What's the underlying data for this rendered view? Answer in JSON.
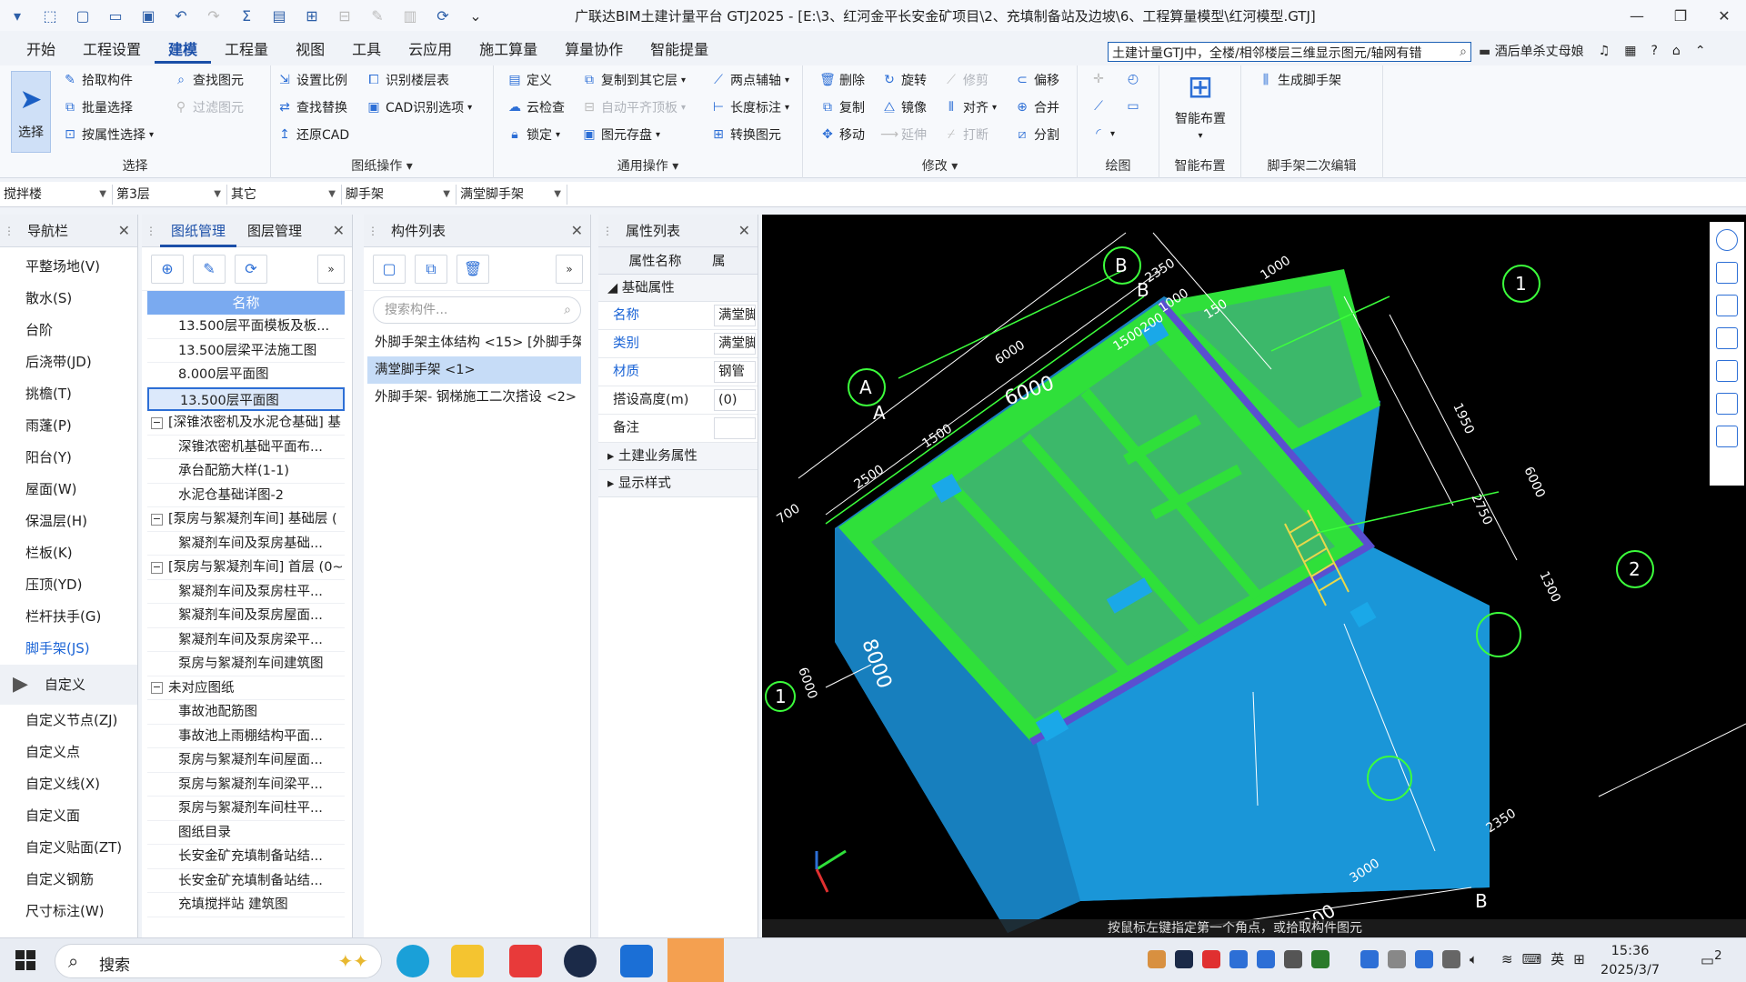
{
  "titlebar": {
    "title": "广联达BIM土建计量平台 GTJ2025 - [E:\\3、红河金平长安金矿项目\\2、充填制备站及边坡\\6、工程算量模型\\红河模型.GTJ]"
  },
  "menu": {
    "tabs": [
      "开始",
      "工程设置",
      "建模",
      "工程量",
      "视图",
      "工具",
      "云应用",
      "施工算量",
      "算量协作",
      "智能提量"
    ],
    "active": "建模",
    "search_value": "土建计量GTJ中，全楼/相邻楼层三维显示图元/轴网有错",
    "news": "酒后单杀丈母娘",
    "help": "?"
  },
  "ribbon": {
    "select_group": {
      "title": "选择",
      "select_btn": "选择",
      "pick": "拾取构件",
      "batch": "批量选择",
      "by_prop": "按属性选择",
      "find": "查找图元",
      "filter": "过滤图元"
    },
    "drawing_group": {
      "title": "图纸操作",
      "set_scale": "设置比例",
      "recog_floor": "识别楼层表",
      "find_replace": "查找替换",
      "cad_options": "CAD识别选项",
      "restore_cad": "还原CAD"
    },
    "general_group": {
      "title": "通用操作",
      "define": "定义",
      "copy_floor": "复制到其它层",
      "two_point": "两点辅轴",
      "cloud_check": "云检查",
      "auto_flat": "自动平齐顶板",
      "length_mark": "长度标注",
      "lock": "锁定",
      "save_elem": "图元存盘",
      "convert": "转换图元"
    },
    "modify_group": {
      "title": "修改",
      "delete": "删除",
      "rotate": "旋转",
      "trim": "修剪",
      "offset": "偏移",
      "copy": "复制",
      "mirror": "镜像",
      "align": "对齐",
      "merge": "合并",
      "move": "移动",
      "extend": "延伸",
      "break": "打断",
      "split": "分割"
    },
    "draw_group": {
      "title": "绘图"
    },
    "smart_group": {
      "title": "智能布置",
      "btn": "智能布置"
    },
    "scaffold_group": {
      "title": "脚手架二次编辑",
      "btn": "生成脚手架"
    }
  },
  "dropbar": {
    "d1": "搅拌楼",
    "d2": "第3层",
    "d3": "其它",
    "d4": "脚手架",
    "d5": "满堂脚手架"
  },
  "nav": {
    "title": "导航栏",
    "items_top": [
      "平整场地(V)",
      "散水(S)",
      "台阶",
      "后浇带(JD)",
      "挑檐(T)",
      "雨蓬(P)",
      "阳台(Y)",
      "屋面(W)",
      "保温层(H)",
      "栏板(K)",
      "压顶(YD)",
      "栏杆扶手(G)",
      "脚手架(JS)"
    ],
    "group": "自定义",
    "items_bottom": [
      "自定义节点(ZJ)",
      "自定义点",
      "自定义线(X)",
      "自定义面",
      "自定义贴面(ZT)",
      "自定义钢筋",
      "尺寸标注(W)"
    ]
  },
  "drawings": {
    "tab1": "图纸管理",
    "tab2": "图层管理",
    "col_name": "名称",
    "rows": [
      {
        "t": "leaf",
        "text": "13.500层平面模板及板..."
      },
      {
        "t": "leaf",
        "text": "13.500层梁平法施工图"
      },
      {
        "t": "leaf",
        "text": "8.000层平面图"
      },
      {
        "t": "sel",
        "text": "13.500层平面图"
      },
      {
        "t": "group",
        "text": "[深锥浓密机及水泥仓基础] 基"
      },
      {
        "t": "leaf",
        "text": "深锥浓密机基础平面布..."
      },
      {
        "t": "leaf",
        "text": "承台配筋大样(1-1)"
      },
      {
        "t": "leaf",
        "text": "水泥仓基础详图-2"
      },
      {
        "t": "group",
        "text": "[泵房与絮凝剂车间] 基础层 ("
      },
      {
        "t": "leaf",
        "text": "絮凝剂车间及泵房基础..."
      },
      {
        "t": "group",
        "text": "[泵房与絮凝剂车间] 首层 (0~"
      },
      {
        "t": "leaf",
        "text": "絮凝剂车间及泵房柱平..."
      },
      {
        "t": "leaf",
        "text": "絮凝剂车间及泵房屋面..."
      },
      {
        "t": "leaf",
        "text": "絮凝剂车间及泵房梁平..."
      },
      {
        "t": "leaf",
        "text": "泵房与絮凝剂车间建筑图"
      },
      {
        "t": "group",
        "text": "未对应图纸"
      },
      {
        "t": "leaf",
        "text": "事故池配筋图"
      },
      {
        "t": "leaf",
        "text": "事故池上雨棚结构平面..."
      },
      {
        "t": "leaf",
        "text": "泵房与絮凝剂车间屋面..."
      },
      {
        "t": "leaf",
        "text": "泵房与絮凝剂车间梁平..."
      },
      {
        "t": "leaf",
        "text": "泵房与絮凝剂车间柱平..."
      },
      {
        "t": "leaf",
        "text": "图纸目录"
      },
      {
        "t": "leaf",
        "text": "长安金矿充填制备站结..."
      },
      {
        "t": "leaf",
        "text": "长安金矿充填制备站结..."
      },
      {
        "t": "leaf",
        "text": "充填搅拌站 建筑图"
      }
    ]
  },
  "components": {
    "title": "构件列表",
    "search_placeholder": "搜索构件...",
    "items": [
      {
        "text": "外脚手架主体结构 <15> [外脚手架",
        "sel": false
      },
      {
        "text": "满堂脚手架 <1>",
        "sel": true
      },
      {
        "text": "外脚手架- 钢梯施工二次搭设 <2>",
        "sel": false
      }
    ]
  },
  "props": {
    "title": "属性列表",
    "col_name": "属性名称",
    "col_value": "属",
    "section_basic": "基础属性",
    "rows": [
      {
        "k": "名称",
        "v": "满堂脚",
        "blue": true
      },
      {
        "k": "类别",
        "v": "满堂脚",
        "blue": true
      },
      {
        "k": "材质",
        "v": "钢管",
        "blue": true
      },
      {
        "k": "搭设高度(m)",
        "v": "(0)",
        "blue": false
      },
      {
        "k": "备注",
        "v": "",
        "blue": false
      }
    ],
    "section_civil": "土建业务属性",
    "section_style": "显示样式"
  },
  "viewport": {
    "status": "按鼠标左键指定第一个角点，或拾取构件图元",
    "dims": [
      "2350",
      "1000",
      "1000",
      "150",
      "6000",
      "6000",
      "1500",
      "200",
      "1500",
      "2500",
      "700",
      "1950",
      "6000",
      "2750",
      "1300",
      "8000",
      "6000",
      "2350",
      "3000",
      "200"
    ],
    "axes": [
      "B",
      "B",
      "A",
      "A",
      "1",
      "2",
      "1",
      "B"
    ]
  },
  "taskbar": {
    "search": "搜索",
    "ime": "英",
    "time": "15:36",
    "date": "2025/3/7",
    "notif_count": "2"
  },
  "colors": {
    "accent": "#1b4fa8",
    "slab_green": "#3cb86a",
    "beam_green": "#2fe03a",
    "wall_blue": "#1a8fd0"
  }
}
